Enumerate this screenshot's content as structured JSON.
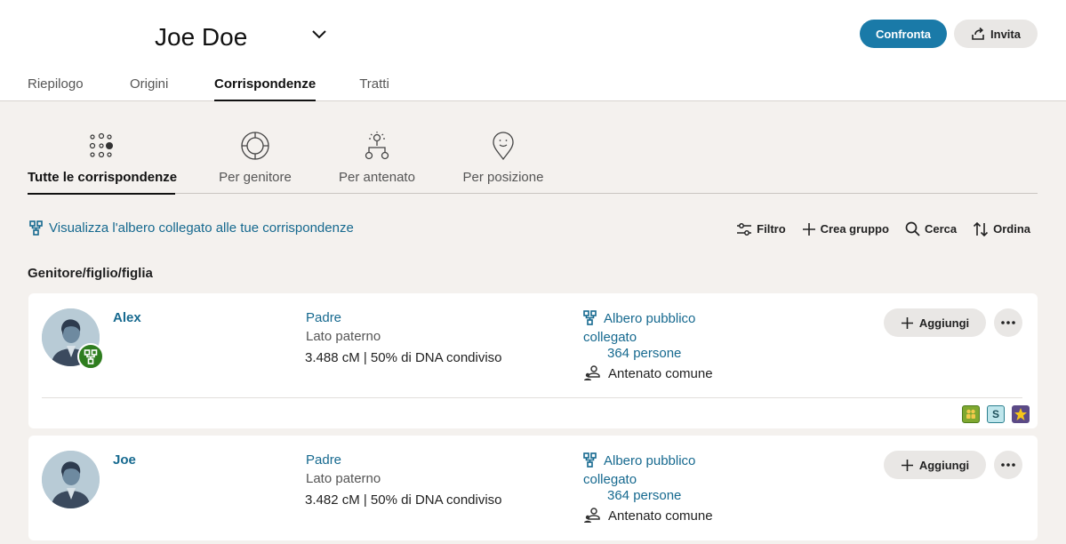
{
  "header": {
    "profile_name": "Joe Doe",
    "compare_label": "Confronta",
    "invite_label": "Invita",
    "tabs": [
      {
        "label": "Riepilogo"
      },
      {
        "label": "Origini"
      },
      {
        "label": "Corrispondenze",
        "active": true
      },
      {
        "label": "Tratti"
      }
    ]
  },
  "subtabs": [
    {
      "label": "Tutte le corrispondenze",
      "icon": "all-matches-icon",
      "active": true
    },
    {
      "label": "Per genitore",
      "icon": "parent-icon"
    },
    {
      "label": "Per antenato",
      "icon": "ancestor-icon"
    },
    {
      "label": "Per posizione",
      "icon": "location-icon"
    }
  ],
  "toolbar": {
    "tree_link": "Visualizza l'albero collegato alle tue corrispondenze",
    "filter": "Filtro",
    "create_group": "Crea gruppo",
    "search": "Cerca",
    "sort": "Ordina"
  },
  "section_title": "Genitore/figlio/figlia",
  "matches": [
    {
      "name": "Alex",
      "relationship": "Padre",
      "side": "Lato paterno",
      "dna": "3.488 cM | 50% di DNA condiviso",
      "tree": "Albero pubblico collegato",
      "persons": "364 persone",
      "ancestor": "Antenato comune",
      "add_label": "Aggiungi",
      "tags": [
        "group-tag-icon",
        "S",
        "star-tag-icon"
      ]
    },
    {
      "name": "Joe",
      "relationship": "Padre",
      "side": "Lato paterno",
      "dna": "3.482 cM | 50% di DNA condiviso",
      "tree": "Albero pubblico collegato",
      "persons": "364 persone",
      "ancestor": "Antenato comune",
      "add_label": "Aggiungi"
    }
  ],
  "colors": {
    "accent": "#1a7aa8",
    "link": "#16698f",
    "badge_green": "#2e7d1e",
    "background": "#f4f1ee"
  }
}
